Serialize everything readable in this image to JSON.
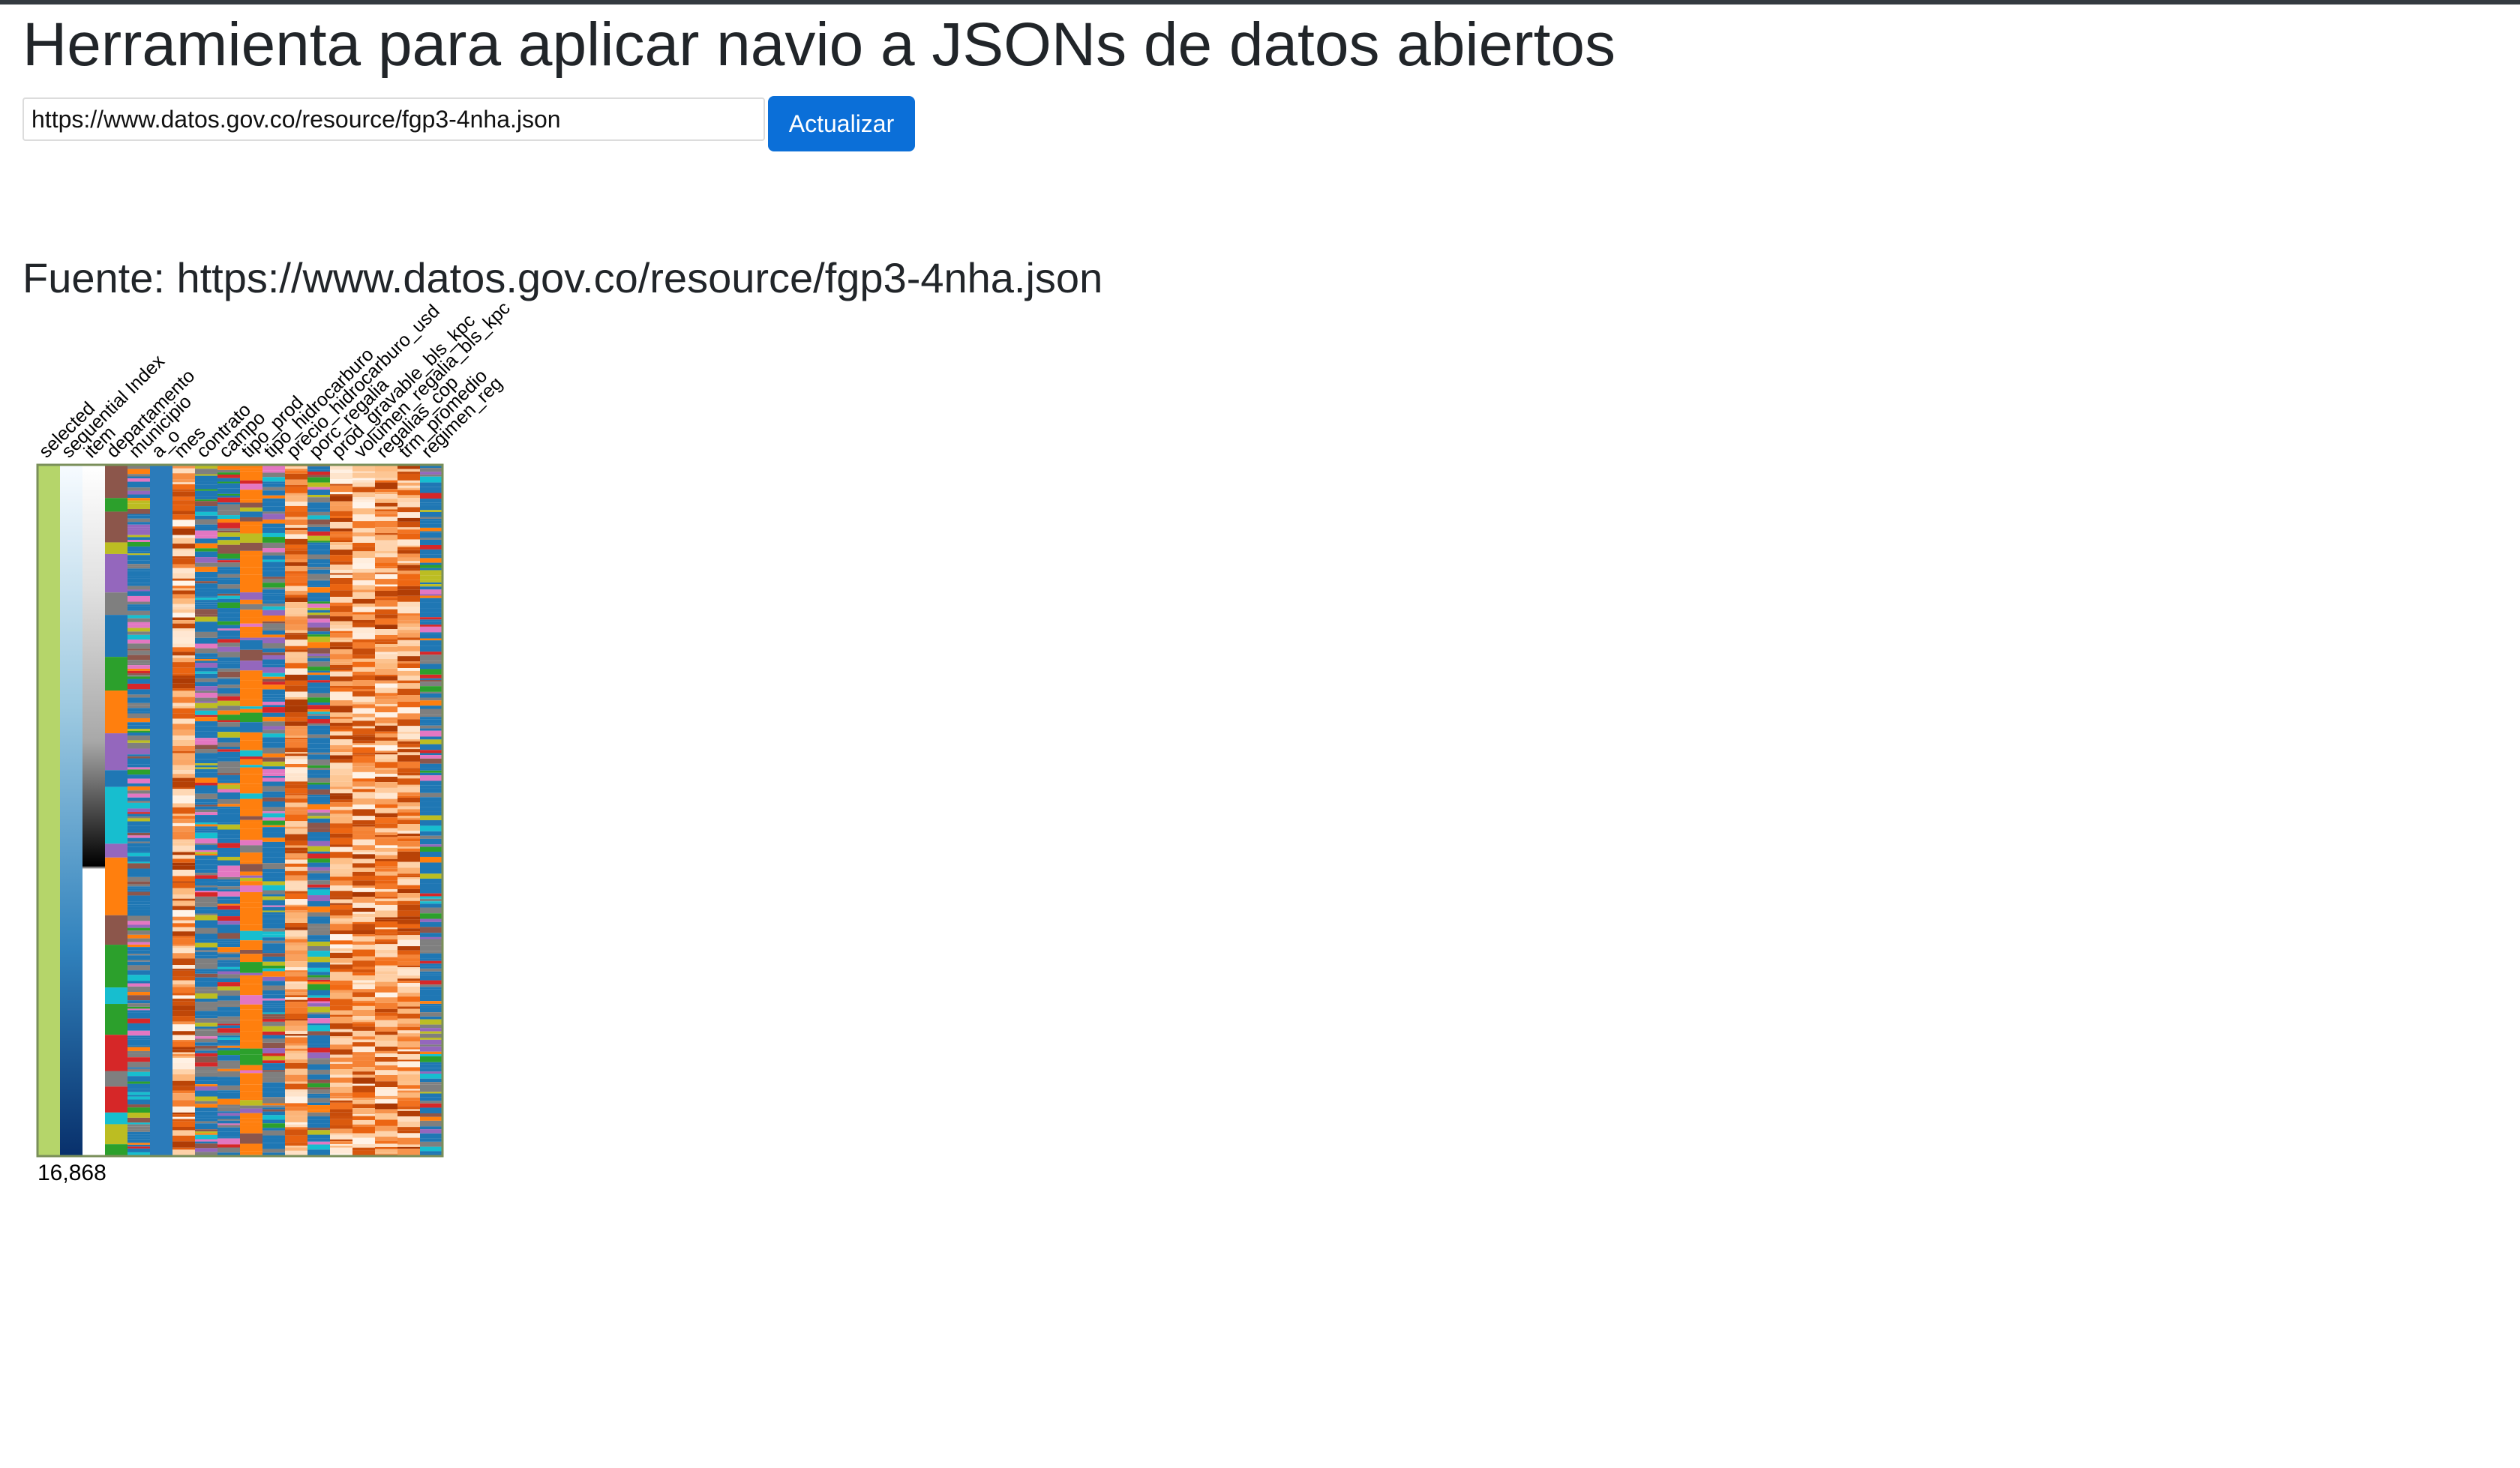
{
  "app": {
    "title": "Herramienta para aplicar navio a JSONs de datos abiertos"
  },
  "form": {
    "url_value": "https://www.datos.gov.co/resource/fgp3-4nha.json",
    "update_label": "Actualizar"
  },
  "source": {
    "heading": "Fuente: https://www.datos.gov.co/resource/fgp3-4nha.json"
  },
  "navio": {
    "record_count": "16,868",
    "attributes": [
      {
        "name": "selected",
        "kind": "selected"
      },
      {
        "name": "sequential Index",
        "kind": "seq-blue"
      },
      {
        "name": "item",
        "kind": "seq-gray"
      },
      {
        "name": "departamento",
        "kind": "cat-blocks"
      },
      {
        "name": "municipio",
        "kind": "cat-stripes"
      },
      {
        "name": "a_o",
        "kind": "solid-blue"
      },
      {
        "name": "mes",
        "kind": "oranges"
      },
      {
        "name": "contrato",
        "kind": "cat-stripes"
      },
      {
        "name": "campo",
        "kind": "cat-stripes"
      },
      {
        "name": "tipo_prod",
        "kind": "cat-orange-mix"
      },
      {
        "name": "tipo_hidrocarburo",
        "kind": "cat-stripes"
      },
      {
        "name": "precio_hidrocarburo_usd",
        "kind": "oranges"
      },
      {
        "name": "porc_regalia",
        "kind": "cat-stripes"
      },
      {
        "name": "prod_gravable_bls_kpc",
        "kind": "oranges"
      },
      {
        "name": "volumen_regalia_bls_kpc",
        "kind": "oranges"
      },
      {
        "name": "regalias_cop",
        "kind": "oranges"
      },
      {
        "name": "trm_promedio",
        "kind": "oranges"
      },
      {
        "name": "regimen_reg",
        "kind": "cat-stripes"
      }
    ],
    "colors": {
      "selected": "#b5d56a",
      "solid_blue": "#2b7bba",
      "categorical": [
        "#1f77b4",
        "#ff7f0e",
        "#2ca02c",
        "#d62728",
        "#9467bd",
        "#8c564b",
        "#e377c2",
        "#7f7f7f",
        "#bcbd22",
        "#17becf"
      ],
      "border": "#7a8f5a"
    }
  }
}
